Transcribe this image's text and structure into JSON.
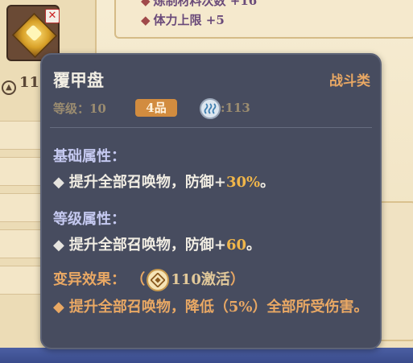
{
  "background": {
    "stats": [
      {
        "diamond": "◆",
        "label": "炼制材料次数",
        "value": "+16"
      },
      {
        "diamond": "◆",
        "label": "体力上限",
        "value": "+5"
      }
    ],
    "left_count": "11",
    "close_symbol": "✕"
  },
  "tooltip": {
    "name": "覆甲盘",
    "category": "战斗类",
    "level": "等级：10",
    "grade": "4品",
    "resource_value": ":113",
    "sections": [
      {
        "title": "基础属性：",
        "text_prefix": "提升全部召唤物，防御+",
        "highlight": "30%",
        "text_suffix": "。"
      },
      {
        "title": "等级属性：",
        "text_prefix": "提升全部召唤物，防御+",
        "highlight": "60",
        "text_suffix": "。"
      }
    ],
    "mutation": {
      "title": "变异效果：",
      "paren_open": "（",
      "activation": "110激活",
      "paren_close": "）",
      "body": "提升全部召唤物，降低（5%）全部所受伤害。"
    },
    "bullet": "◆"
  },
  "colors": {
    "tooltip_bg": "#474c5f",
    "highlight": "#f0b64a",
    "section_title": "#c5c9f0",
    "category": "#e9a864",
    "grade_badge": "#d28c3f"
  }
}
